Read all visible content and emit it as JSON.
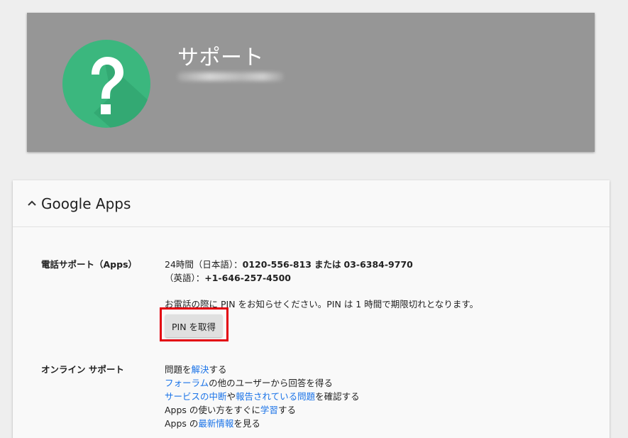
{
  "banner": {
    "title": "サポート",
    "subtitle": "████████████"
  },
  "card": {
    "title": "Google Apps",
    "phone": {
      "label": "電話サポート（Apps）",
      "line1_prefix": "24時間（日本語）：",
      "line1_number1": "0120-556-813",
      "line1_or": "または",
      "line1_number2": "03-6384-9770",
      "line2_prefix": "（英語）：",
      "line2_number": "+1-646-257-4500",
      "pin_notice": "お電話の際に PIN をお知らせください。PIN は 1 時間で期限切れとなります。",
      "pin_button": "PIN を取得"
    },
    "online": {
      "label": "オンライン サポート",
      "l1_a": "問題を",
      "l1_link": "解決",
      "l1_b": "する",
      "l2_link": "フォーラム",
      "l2_b": "の他のユーザーから回答を得る",
      "l3_link1": "サービスの中断",
      "l3_mid": "や",
      "l3_link2": "報告されている問題",
      "l3_b": "を確認する",
      "l4_a": "Apps の使い方をすぐに",
      "l4_link": "学習",
      "l4_b": "する",
      "l5_a": "Apps の",
      "l5_link": "最新情報",
      "l5_b": "を見る"
    }
  },
  "colors": {
    "banner_bg": "#969696",
    "icon_green": "#3bb77e",
    "link": "#1a73e8",
    "highlight": "#e3000f"
  },
  "icons": [
    "help-icon",
    "chevron-up-icon"
  ]
}
